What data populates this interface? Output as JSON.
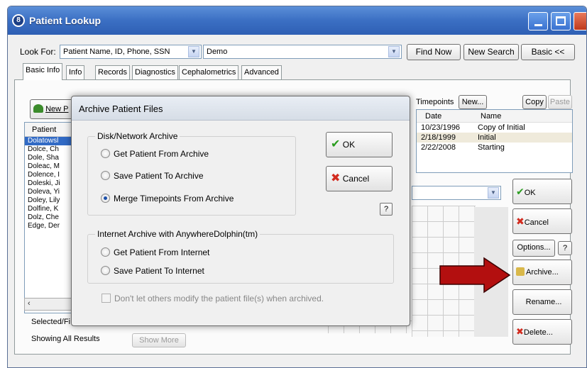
{
  "window": {
    "title": "Patient Lookup"
  },
  "toolbar": {
    "look_for_label": "Look For:",
    "look_for_value": "Patient Name, ID, Phone, SSN",
    "search_value": "Demo",
    "find_now": "Find Now",
    "new_search": "New Search",
    "basic": "Basic <<"
  },
  "tabs": [
    "Basic Info",
    "Info",
    "Records",
    "Diagnostics",
    "Cephalometrics",
    "Advanced"
  ],
  "left": {
    "new_button": "New P",
    "patient_header": "Patient",
    "patients": [
      "Dolatowsl",
      "Dolce, Ch",
      "Dole, Sha",
      "Doleac, M",
      "Dolence, I",
      "Doleski, Ji",
      "Doleva, Yi",
      "Doley, Lily",
      "Dolfine, K",
      "Dolz, Che",
      "Edge, Der"
    ],
    "selected_label": "Selected/Fi",
    "showing": "Showing All Results",
    "show_more": "Show More"
  },
  "timepoints": {
    "label": "Timepoints",
    "new_button": "New...",
    "copy_button": "Copy",
    "paste_button": "Paste",
    "col_date": "Date",
    "col_name": "Name",
    "rows": [
      {
        "date": "10/23/1996",
        "name": "Copy of Initial"
      },
      {
        "date": "2/18/1999",
        "name": "Initial"
      },
      {
        "date": "2/22/2008",
        "name": "Starting"
      }
    ]
  },
  "side_buttons": {
    "ok": "OK",
    "cancel": "Cancel",
    "options": "Options...",
    "help": "?",
    "archive": "Archive...",
    "rename": "Rename...",
    "delete": "Delete..."
  },
  "dialog": {
    "title": "Archive Patient Files",
    "disk_group": "Disk/Network Archive",
    "disk_options": [
      "Get Patient From Archive",
      "Save Patient To Archive",
      "Merge Timepoints From Archive"
    ],
    "disk_selected": 2,
    "internet_group": "Internet Archive with AnywhereDolphin(tm)",
    "internet_options": [
      "Get Patient From Internet",
      "Save Patient To Internet"
    ],
    "ok": "OK",
    "cancel": "Cancel",
    "help": "?",
    "dont_modify": "Don't let others modify the patient file(s) when archived."
  },
  "colors": {
    "title_blue": "#3b6fc3",
    "ok_green": "#2a9d1f",
    "cancel_red": "#d22b1f",
    "arrow_red": "#b30f0f"
  }
}
